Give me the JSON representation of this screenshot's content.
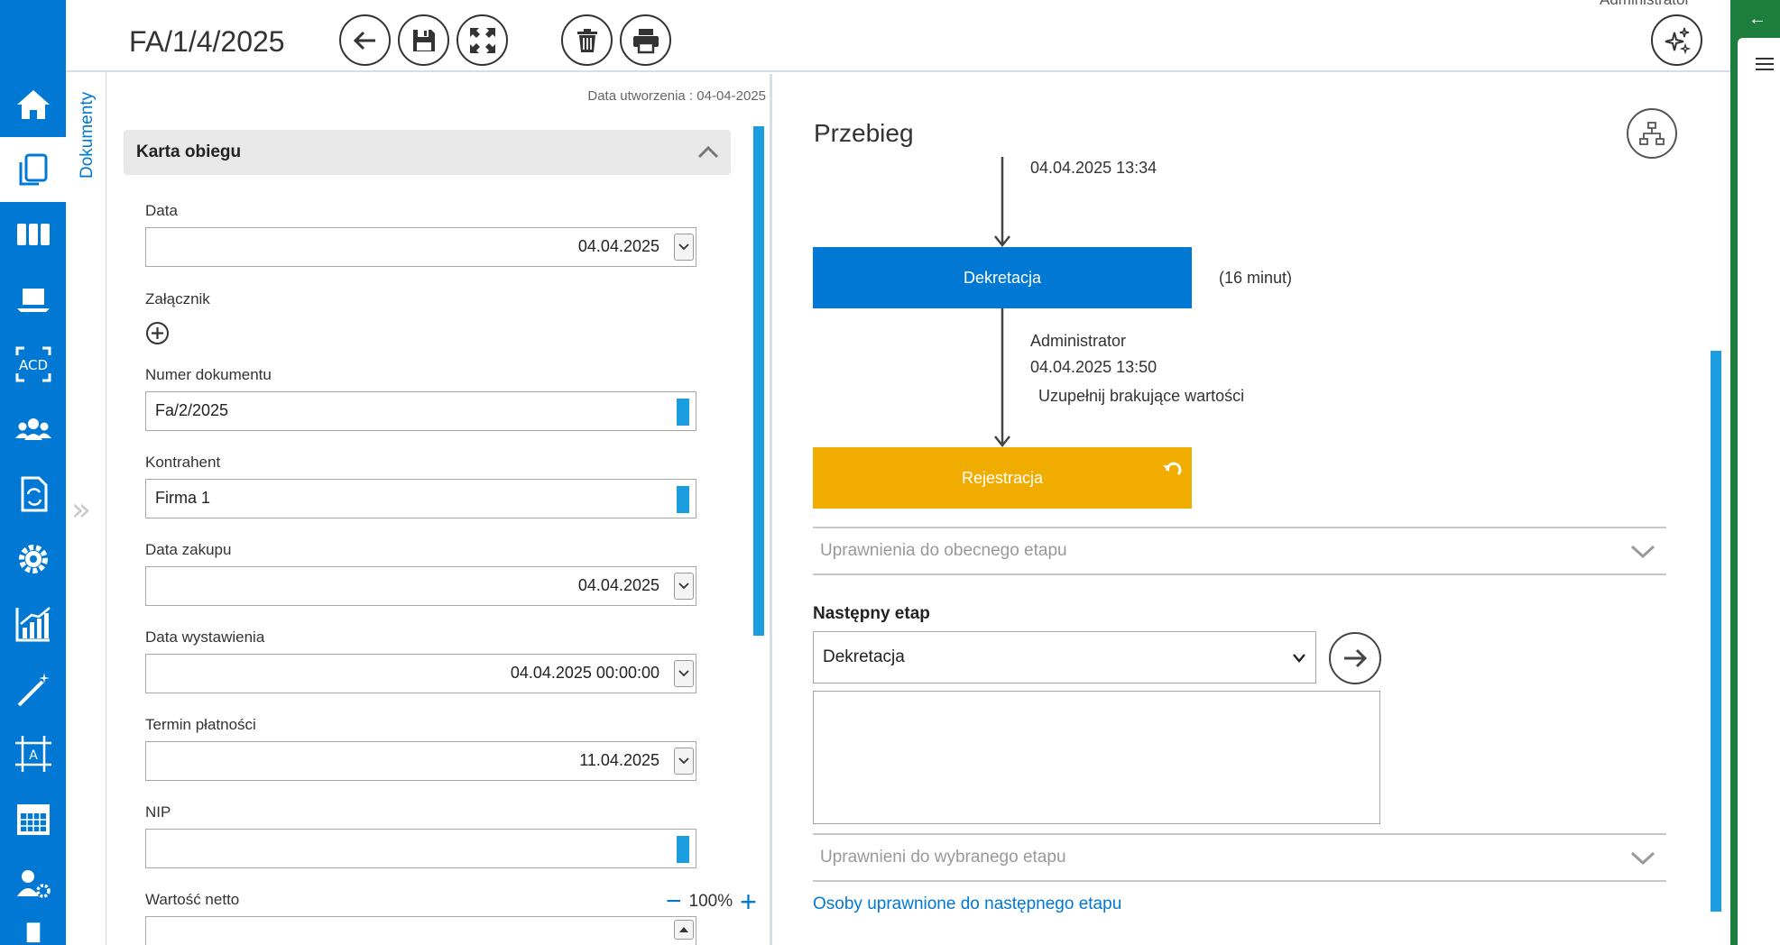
{
  "header": {
    "doc_title": "FA/1/4/2025",
    "top_right_text": "Administrator"
  },
  "side_tab": {
    "label": "Dokumenty"
  },
  "form": {
    "created": "Data utworzenia : 04-04-2025",
    "section_title": "Karta obiegu",
    "fields": {
      "data": {
        "label": "Data",
        "value": "04.04.2025"
      },
      "zalacznik": {
        "label": "Załącznik"
      },
      "numer": {
        "label": "Numer dokumentu",
        "value": "Fa/2/2025"
      },
      "kontrahent": {
        "label": "Kontrahent",
        "value": "Firma 1"
      },
      "data_zakupu": {
        "label": "Data zakupu",
        "value": "04.04.2025"
      },
      "data_wystawienia": {
        "label": "Data wystawienia",
        "value": "04.04.2025 00:00:00"
      },
      "termin": {
        "label": "Termin płatności",
        "value": "11.04.2025"
      },
      "nip": {
        "label": "NIP",
        "value": ""
      },
      "wartosc_netto": {
        "label": "Wartość netto",
        "value": ""
      }
    },
    "zoom": {
      "level": "100%",
      "minus": "−",
      "plus": "+"
    }
  },
  "workflow": {
    "title": "Przebieg",
    "first_timestamp": "04.04.2025 13:34",
    "stage1": {
      "label": "Dekretacja",
      "duration": "(16 minut)"
    },
    "transition_user": "Administrator",
    "transition_time": "04.04.2025 13:50",
    "transition_note": "Uzupełnij brakujące wartości",
    "stage2": {
      "label": "Rejestracja"
    },
    "accordion_current": "Uprawnienia do obecnego etapu",
    "next_stage_label": "Następny etap",
    "next_stage_value": "Dekretacja",
    "accordion_selected": "Uprawnieni do wybranego etapu",
    "link": "Osoby uprawnione do następnego etapu"
  },
  "colors": {
    "nav": "#0078d4",
    "stage_blue": "#0078d4",
    "stage_yellow": "#f0ad00",
    "scrollbar": "#1b9de0",
    "edge_green": "#1e7e3e"
  }
}
